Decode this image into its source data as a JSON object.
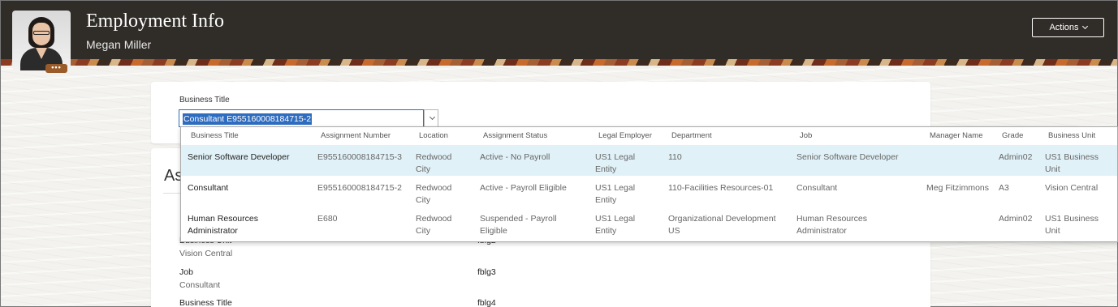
{
  "header": {
    "title": "Employment Info",
    "person_name": "Megan Miller",
    "avatar_more": "•••",
    "actions_label": "Actions"
  },
  "business_title_field": {
    "label": "Business Title",
    "value": "Consultant E955160008184715-2"
  },
  "section": {
    "heading": "As"
  },
  "info_fields": [
    {
      "label": "Business Unit",
      "value": "Vision Central",
      "flex_label": "fblg2"
    },
    {
      "label": "Job",
      "value": "Consultant",
      "flex_label": "fblg3"
    },
    {
      "label": "Business Title",
      "value": "",
      "flex_label": "fblg4"
    }
  ],
  "dropdown": {
    "columns": [
      "Business Title",
      "Assignment Number",
      "Location",
      "Assignment Status",
      "Legal Employer",
      "Department",
      "Job",
      "Manager Name",
      "Grade",
      "Business Unit"
    ],
    "rows": [
      {
        "business_title": "Senior Software Developer",
        "assignment_number": "E955160008184715-3",
        "location": "Redwood City",
        "assignment_status": "Active - No Payroll",
        "legal_employer": "US1 Legal Entity",
        "department": "110",
        "job": "Senior Software Developer",
        "manager_name": "",
        "grade": "Admin02",
        "business_unit": "US1 Business Unit"
      },
      {
        "business_title": "Consultant",
        "assignment_number": "E955160008184715-2",
        "location": "Redwood City",
        "assignment_status": "Active - Payroll Eligible",
        "legal_employer": "US1 Legal Entity",
        "department": "110-Facilities Resources-01",
        "job": "Consultant",
        "manager_name": "Meg Fitzimmons",
        "grade": "A3",
        "business_unit": "Vision Central"
      },
      {
        "business_title": "Human Resources Administrator",
        "assignment_number": "E680",
        "location": "Redwood City",
        "assignment_status": "Suspended - Payroll Eligible",
        "legal_employer": "US1 Legal Entity",
        "department": "Organizational Development US",
        "job": "Human Resources Administrator",
        "manager_name": "",
        "grade": "Admin02",
        "business_unit": "US1 Business Unit"
      }
    ]
  },
  "colors": {
    "header_bg": "#302c28",
    "selection": "#2e6cbf",
    "row_highlight": "#e1f1f8"
  }
}
